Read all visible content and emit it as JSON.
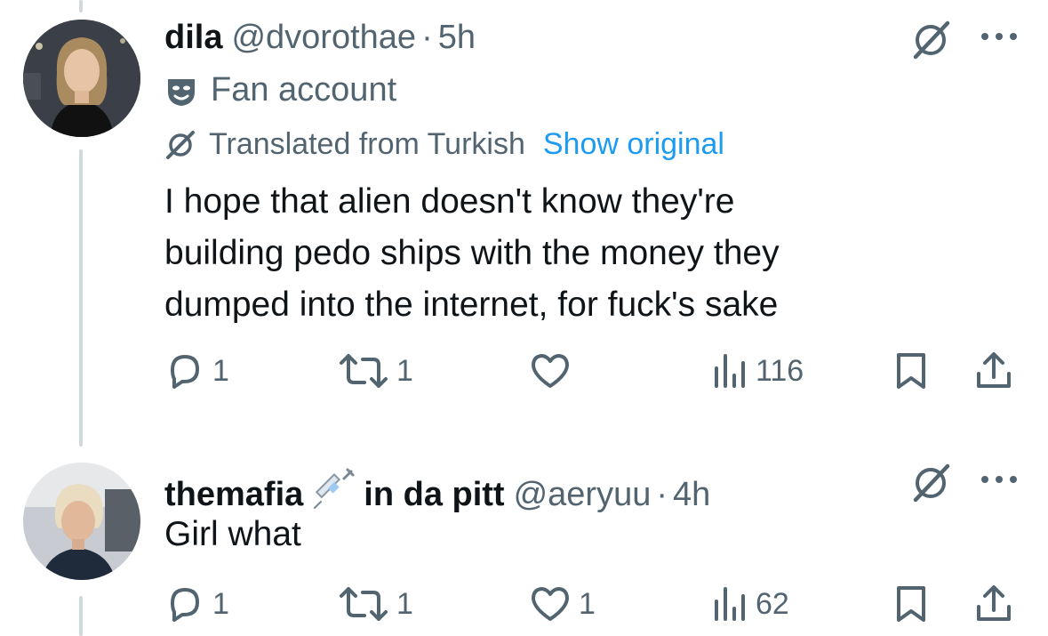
{
  "tweets": [
    {
      "name": "dila",
      "handle": "@dvorothae",
      "separator": "·",
      "time": "5h",
      "label": "Fan account",
      "translated_text": "Translated from Turkish",
      "show_original": "Show original",
      "text_lines": [
        "I hope that alien doesn't know they're",
        "building pedo ships with the money they",
        "dumped into the internet, for fuck's sake"
      ],
      "replies": "1",
      "reposts": "1",
      "likes": "",
      "views": "116"
    },
    {
      "name": "themafia",
      "name_suffix": "in da pitt",
      "handle": "@aeryuu",
      "separator": "·",
      "time": "4h",
      "text": "Girl what",
      "replies": "1",
      "reposts": "1",
      "likes": "1",
      "views": "62"
    }
  ],
  "icons": {
    "reply": "reply-icon",
    "repost": "repost-icon",
    "like": "heart-icon",
    "views": "views-icon",
    "bookmark": "bookmark-icon",
    "share": "share-icon",
    "grok": "grok-icon",
    "more": "more-icon",
    "fan": "fan-account-mask-icon",
    "badge": "syringe-emoji"
  },
  "colors": {
    "text": "#0f1419",
    "secondary": "#536471",
    "link": "#1d9bf0",
    "thread_line": "#cfd9de"
  }
}
